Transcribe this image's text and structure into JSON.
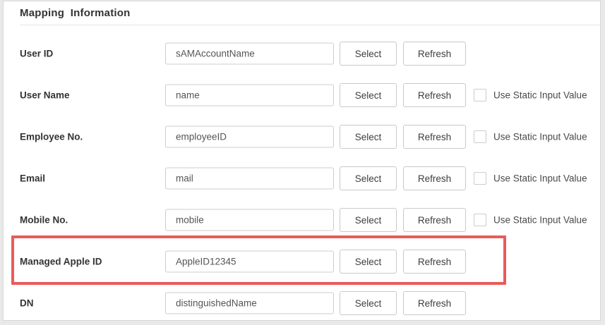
{
  "panel": {
    "title": "Mapping  Information"
  },
  "buttons": {
    "select": "Select",
    "refresh": "Refresh"
  },
  "checkbox": {
    "label": "Use Static Input Value",
    "checked": false
  },
  "rows": [
    {
      "label": "User ID",
      "value": "sAMAccountName",
      "has_checkbox": false,
      "highlighted": false
    },
    {
      "label": "User Name",
      "value": "name",
      "has_checkbox": true,
      "highlighted": false
    },
    {
      "label": "Employee No.",
      "value": "employeeID",
      "has_checkbox": true,
      "highlighted": false
    },
    {
      "label": "Email",
      "value": "mail",
      "has_checkbox": true,
      "highlighted": false
    },
    {
      "label": "Mobile No.",
      "value": "mobile",
      "has_checkbox": true,
      "highlighted": false
    },
    {
      "label": "Managed Apple ID",
      "value": "AppleID12345",
      "has_checkbox": false,
      "highlighted": true
    },
    {
      "label": "DN",
      "value": "distinguishedName",
      "has_checkbox": false,
      "highlighted": false
    }
  ],
  "colors": {
    "highlight_border": "#eb5a5a",
    "panel_border": "#d8d8d8",
    "control_border": "#cccccc",
    "label_text": "#333333",
    "input_text": "#555555",
    "page_background": "#e9e9e9"
  }
}
